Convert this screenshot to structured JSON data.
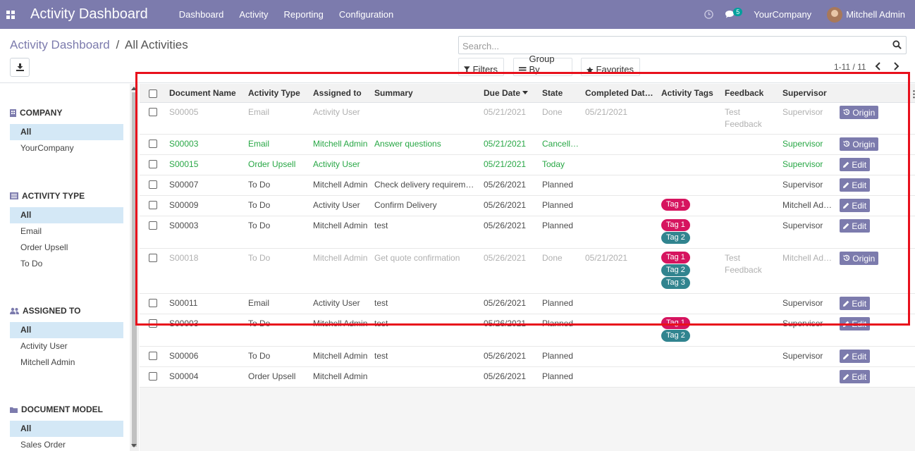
{
  "topbar": {
    "title": "Activity Dashboard",
    "menu": [
      "Dashboard",
      "Activity",
      "Reporting",
      "Configuration"
    ],
    "messages_count": "5",
    "company": "YourCompany",
    "user": "Mitchell Admin"
  },
  "breadcrumb": {
    "parent": "Activity Dashboard",
    "sep": "/",
    "current": "All Activities"
  },
  "search": {
    "placeholder": "Search..."
  },
  "filters": {
    "filters_label": "Filters",
    "groupby_label": "Group By",
    "favorites_label": "Favorites"
  },
  "pager": {
    "text": "1-11 / 11"
  },
  "sidebar": {
    "company": {
      "title": "COMPANY",
      "items": [
        "All",
        "YourCompany"
      ]
    },
    "activity_type": {
      "title": "ACTIVITY TYPE",
      "items": [
        "All",
        "Email",
        "Order Upsell",
        "To Do"
      ]
    },
    "assigned_to": {
      "title": "ASSIGNED TO",
      "items": [
        "All",
        "Activity User",
        "Mitchell Admin"
      ]
    },
    "document_model": {
      "title": "DOCUMENT MODEL",
      "items": [
        "All",
        "Sales Order"
      ]
    }
  },
  "table": {
    "headers": [
      "Document Name",
      "Activity Type",
      "Assigned to",
      "Summary",
      "Due Date",
      "State",
      "Completed Dat…",
      "Activity Tags",
      "Feedback",
      "Supervisor"
    ],
    "edit_label": "Edit",
    "origin_label": "Origin",
    "rows": [
      {
        "doc": "S00005",
        "type": "Email",
        "assigned": "Activity User",
        "summary": "",
        "due": "05/21/2021",
        "state": "Done",
        "completed": "05/21/2021",
        "tags": [],
        "feedback": "Test Feedback",
        "supervisor": "Supervisor"
      },
      {
        "doc": "S00003",
        "type": "Email",
        "assigned": "Mitchell Admin",
        "summary": "Answer questions",
        "due": "05/21/2021",
        "state": "Cancelled",
        "completed": "",
        "tags": [],
        "feedback": "",
        "supervisor": "Supervisor"
      },
      {
        "doc": "S00015",
        "type": "Order Upsell",
        "assigned": "Activity User",
        "summary": "",
        "due": "05/21/2021",
        "state": "Today",
        "completed": "",
        "tags": [],
        "feedback": "",
        "supervisor": "Supervisor"
      },
      {
        "doc": "S00007",
        "type": "To Do",
        "assigned": "Mitchell Admin",
        "summary": "Check delivery requirements",
        "due": "05/26/2021",
        "state": "Planned",
        "completed": "",
        "tags": [],
        "feedback": "",
        "supervisor": "Supervisor"
      },
      {
        "doc": "S00009",
        "type": "To Do",
        "assigned": "Activity User",
        "summary": "Confirm Delivery",
        "due": "05/26/2021",
        "state": "Planned",
        "completed": "",
        "tags": [
          "Tag 1"
        ],
        "feedback": "",
        "supervisor": "Mitchell Ad…"
      },
      {
        "doc": "S00003",
        "type": "To Do",
        "assigned": "Mitchell Admin",
        "summary": "test",
        "due": "05/26/2021",
        "state": "Planned",
        "completed": "",
        "tags": [
          "Tag 1",
          "Tag 2"
        ],
        "feedback": "",
        "supervisor": "Supervisor"
      },
      {
        "doc": "S00018",
        "type": "To Do",
        "assigned": "Mitchell Admin",
        "summary": "Get quote confirmation",
        "due": "05/26/2021",
        "state": "Done",
        "completed": "05/21/2021",
        "tags": [
          "Tag 1",
          "Tag 2",
          "Tag 3"
        ],
        "feedback": "Test Feedback",
        "supervisor": "Mitchell Ad…"
      },
      {
        "doc": "S00011",
        "type": "Email",
        "assigned": "Activity User",
        "summary": "test",
        "due": "05/26/2021",
        "state": "Planned",
        "completed": "",
        "tags": [],
        "feedback": "",
        "supervisor": "Supervisor"
      },
      {
        "doc": "S00003",
        "type": "To Do",
        "assigned": "Mitchell Admin",
        "summary": "test",
        "due": "05/26/2021",
        "state": "Planned",
        "completed": "",
        "tags": [
          "Tag 1",
          "Tag 2"
        ],
        "feedback": "",
        "supervisor": "Supervisor"
      },
      {
        "doc": "S00006",
        "type": "To Do",
        "assigned": "Mitchell Admin",
        "summary": "test",
        "due": "05/26/2021",
        "state": "Planned",
        "completed": "",
        "tags": [],
        "feedback": "",
        "supervisor": "Supervisor"
      },
      {
        "doc": "S00004",
        "type": "Order Upsell",
        "assigned": "Mitchell Admin",
        "summary": "",
        "due": "05/26/2021",
        "state": "Planned",
        "completed": "",
        "tags": [],
        "feedback": "",
        "supervisor": ""
      }
    ]
  }
}
